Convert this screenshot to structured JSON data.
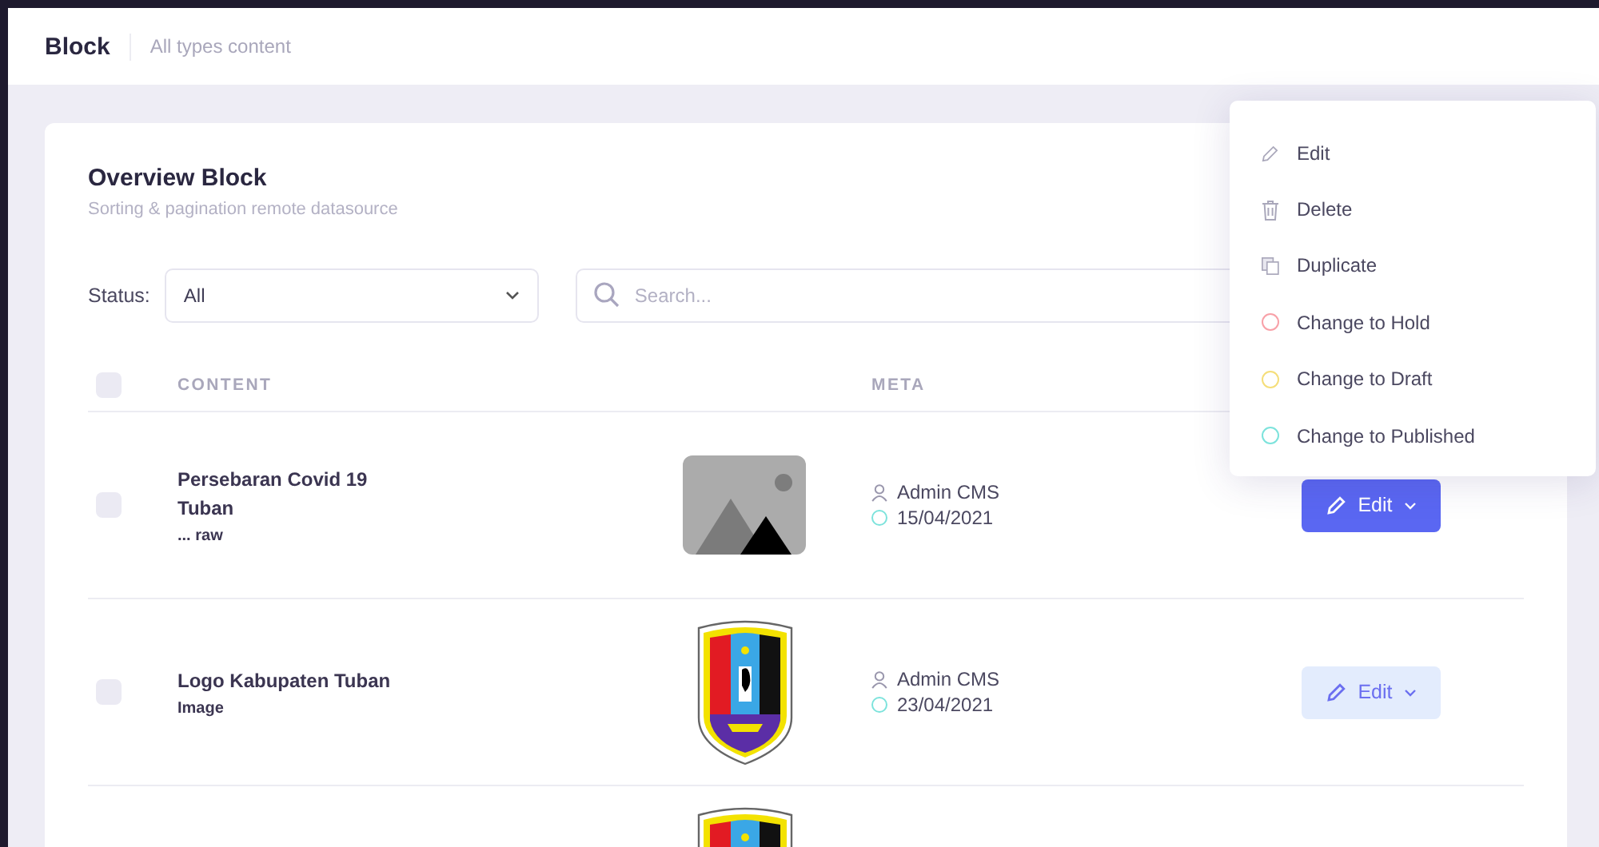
{
  "header": {
    "title": "Block",
    "subtitle": "All types content"
  },
  "card": {
    "title": "Overview Block",
    "subtitle": "Sorting & pagination remote datasource"
  },
  "filters": {
    "status_label": "Status:",
    "status_value": "All",
    "search_placeholder": "Search..."
  },
  "table": {
    "select_all_checked": false,
    "columns": [
      "CONTENT",
      "META"
    ],
    "rows": [
      {
        "title": "Persebaran Covid 19 Tuban",
        "type": "... raw",
        "kind": "placeholder",
        "author": "Admin CMS",
        "date": "15/04/2021",
        "color": "#7de3dc",
        "checked": false,
        "action": "Edit",
        "menu_open": true
      },
      {
        "title": "Logo Kabupaten Tuban",
        "type": "Image",
        "kind": "emblem",
        "author": "Admin CMS",
        "date": "23/04/2021",
        "color": "#7de3dc",
        "checked": false,
        "action": "Edit",
        "menu_open": false
      },
      {
        "kind": "emblem"
      }
    ]
  },
  "menu": [
    {
      "kind": "edit",
      "label": "Edit"
    },
    {
      "kind": "delete",
      "label": "Delete"
    },
    {
      "kind": "duplicate",
      "label": "Duplicate"
    },
    {
      "kind": "status",
      "label": "Change to Hold",
      "color": "#f8a1a8"
    },
    {
      "kind": "status",
      "label": "Change to Draft",
      "color": "#f5de7a"
    },
    {
      "kind": "status",
      "label": "Change to Published",
      "color": "#7de3dc"
    }
  ]
}
